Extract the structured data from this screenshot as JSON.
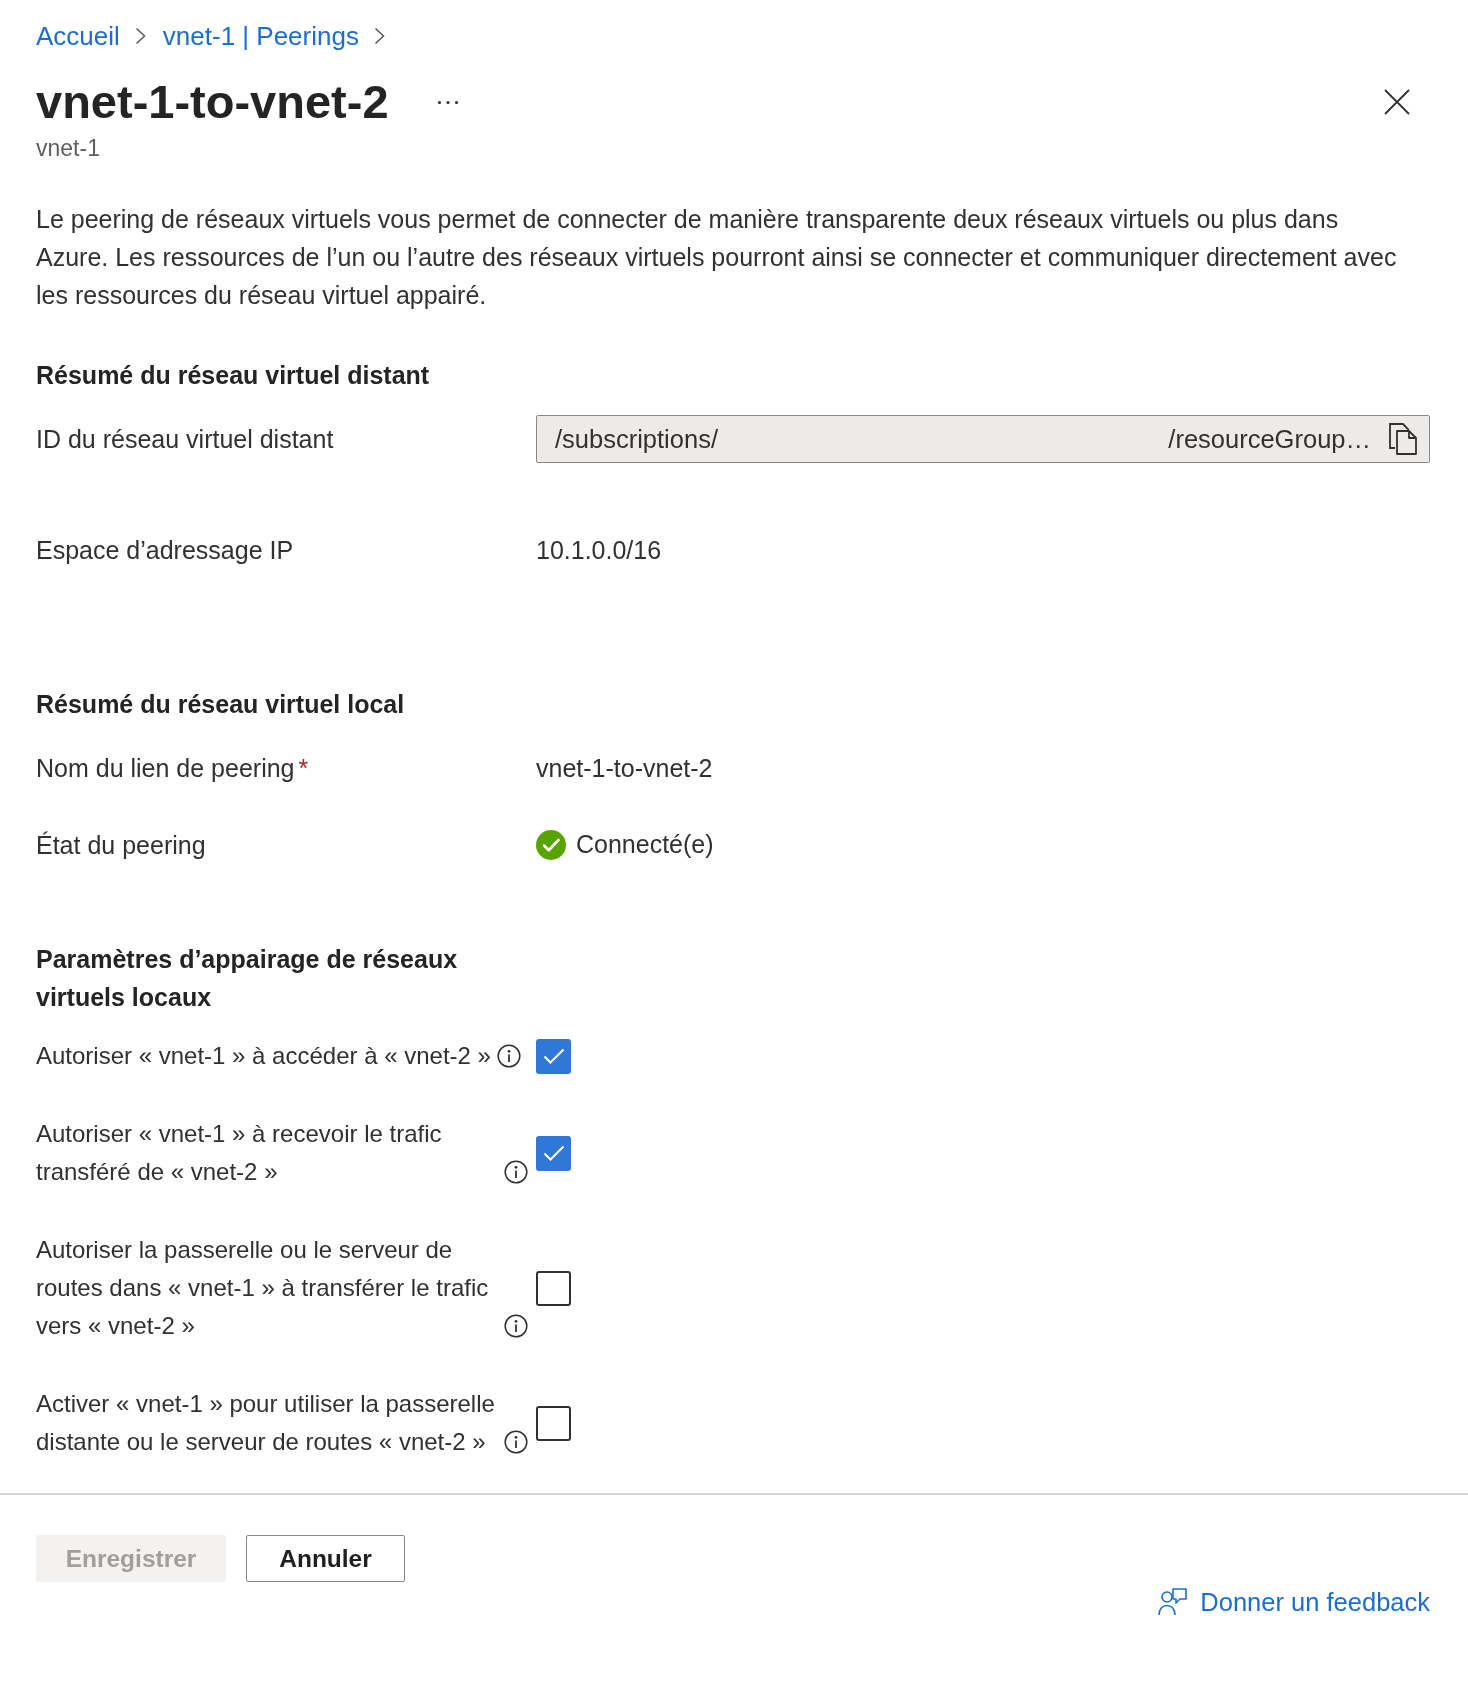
{
  "breadcrumb": [
    {
      "label": "Accueil"
    },
    {
      "label": "vnet-1 | Peerings"
    }
  ],
  "header": {
    "title": "vnet-1-to-vnet-2",
    "subtitle": "vnet-1"
  },
  "description": "Le peering de réseaux virtuels vous permet de connecter de manière transparente deux réseaux virtuels ou plus dans Azure. Les ressources de l’un ou l’autre des réseaux virtuels pourront ainsi se connecter et communiquer directement avec les ressources du réseau virtuel appairé.",
  "sections": [
    {
      "heading": "Résumé du réseau virtuel distant",
      "rows": [
        {
          "kind": "readonly_field",
          "label": "ID du réseau virtuel distant",
          "value_start": "/subscriptions/",
          "value_end": "/resourceGroup…"
        },
        {
          "kind": "address_space",
          "label": "Espace d’adressage IP",
          "value": "10.1.0.0/16"
        }
      ]
    },
    {
      "heading": "Résumé du réseau virtuel local",
      "rows": [
        {
          "kind": "text",
          "label": "Nom du lien de peering",
          "required_mark": "*",
          "value": "vnet-1-to-vnet-2"
        },
        {
          "kind": "status",
          "label": "État du peering",
          "value": "Connecté(e)"
        }
      ]
    },
    {
      "heading": "Paramètres d’appairage de réseaux virtuels locaux",
      "rows": [
        {
          "kind": "checkbox",
          "label": "Autoriser « vnet-1 » à accéder à « vnet-2 »",
          "checked": true
        },
        {
          "kind": "checkbox",
          "label": "Autoriser « vnet-1 » à recevoir le trafic transféré de « vnet-2 »",
          "checked": true
        },
        {
          "kind": "checkbox",
          "label": "Autoriser la passerelle ou le serveur de routes dans « vnet-1 » à transférer le trafic vers « vnet-2 »",
          "checked": false
        },
        {
          "kind": "checkbox",
          "label": "Activer « vnet-1 » pour utiliser la passerelle distante ou le serveur de routes « vnet-2 »",
          "checked": false
        }
      ]
    }
  ],
  "footer": {
    "buttons": [
      {
        "label": "Enregistrer",
        "disabled": true
      },
      {
        "label": "Annuler",
        "disabled": false
      }
    ],
    "feedback_link": "Donner un feedback"
  }
}
